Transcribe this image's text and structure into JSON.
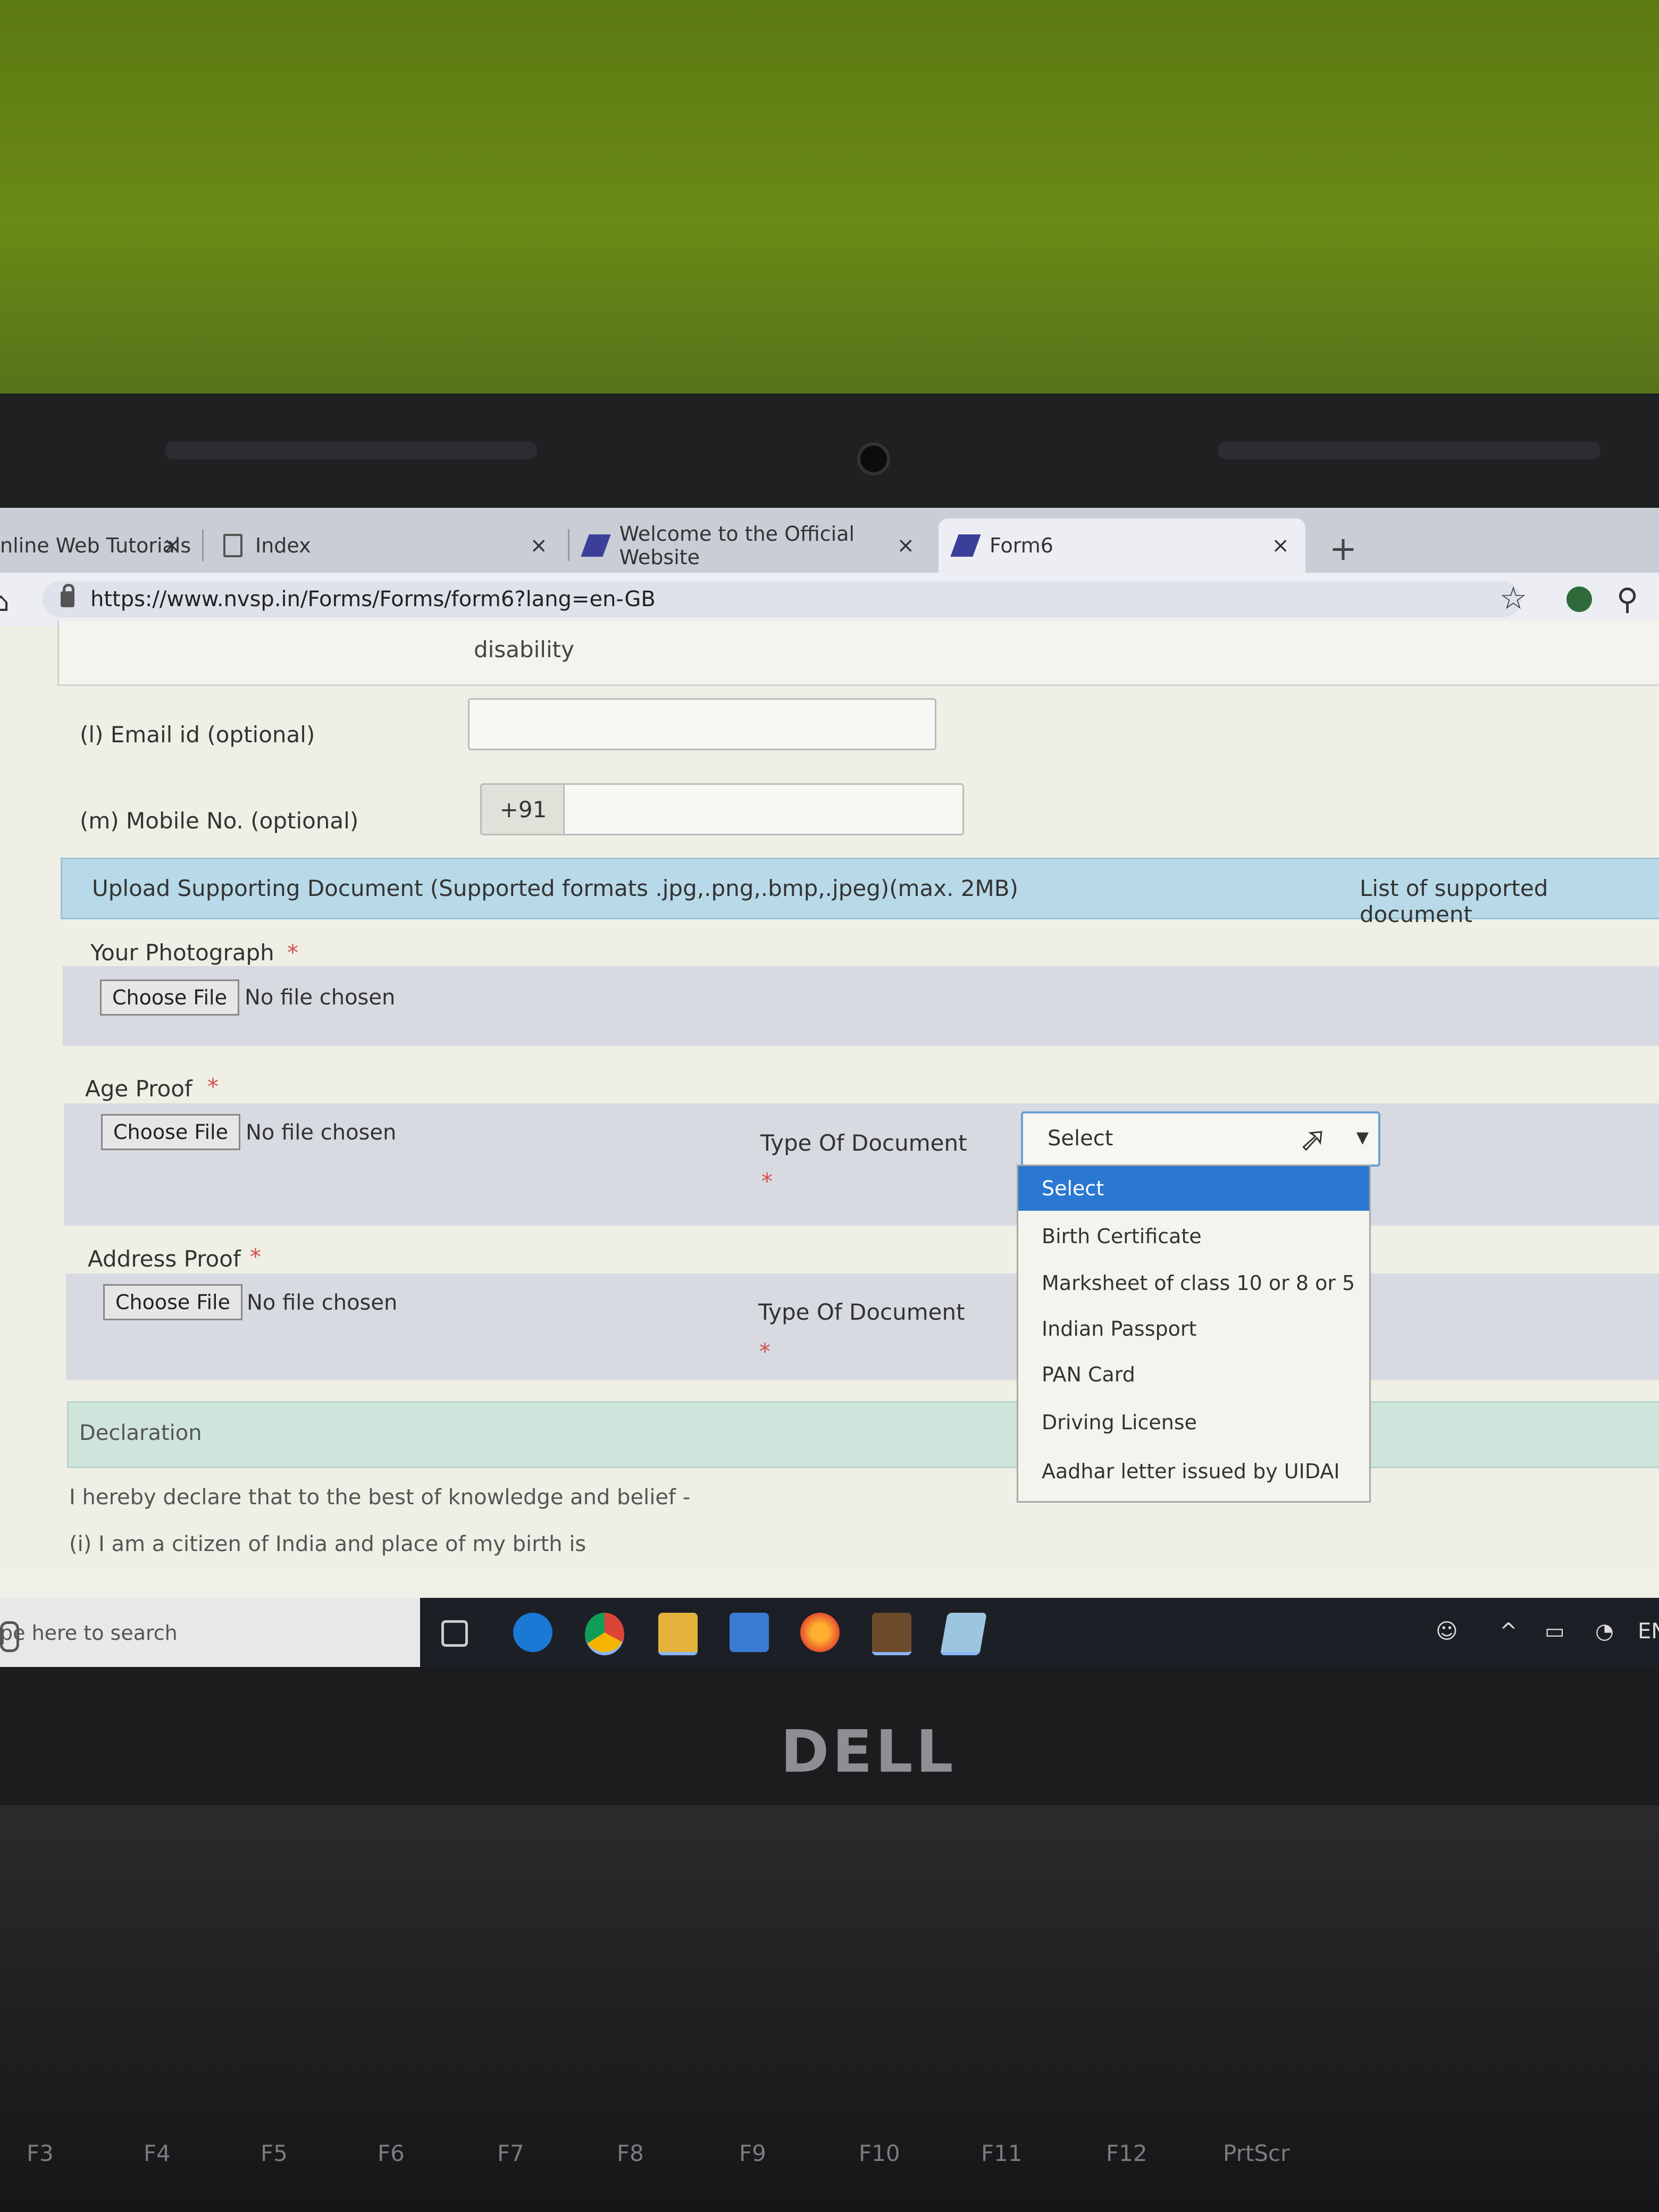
{
  "browser": {
    "tabs": [
      {
        "title": "nline Web Tutorials"
      },
      {
        "title": "Index"
      },
      {
        "title": "Welcome to the Official Website"
      },
      {
        "title": "Form6"
      }
    ],
    "close_glyph": "×",
    "new_tab_glyph": "+",
    "url": "https://www.nvsp.in/Forms/Forms/form6?lang=en-GB"
  },
  "form": {
    "disability_text": "disability",
    "email_label": "(l) Email id (optional)",
    "email_value": "",
    "mobile_label": "(m) Mobile No. (optional)",
    "mobile_prefix": "+91",
    "mobile_value": "",
    "upload_header": "Upload Supporting Document (Supported formats .jpg,.png,.bmp,.jpeg)(max. 2MB)",
    "supported_list_link": "List of supported document",
    "required_mark": "*",
    "photo": {
      "label": "Your Photograph",
      "button": "Choose File",
      "status": "No file chosen"
    },
    "age_proof": {
      "label": "Age Proof",
      "button": "Choose File",
      "status": "No file chosen",
      "doc_type_label": "Type Of Document",
      "select_value": "Select"
    },
    "address_proof": {
      "label": "Address Proof",
      "button": "Choose File",
      "status": "No file chosen",
      "doc_type_label": "Type Of Document"
    },
    "declaration_header": "Declaration",
    "declaration_text": "I hereby declare that to the best of knowledge and belief -",
    "declaration_item_1": "(i) I am a citizen of India and place of my birth is"
  },
  "dropdown": {
    "options": [
      "Select",
      "Birth Certificate",
      "Marksheet of class 10 or 8 or 5",
      "Indian Passport",
      "PAN Card",
      "Driving License",
      "Aadhar letter issued by UIDAI"
    ],
    "selected_index": 0,
    "highlight_color": "#2a78d2"
  },
  "taskbar": {
    "search_placeholder": "pe here to search",
    "language": "EN",
    "icons": [
      "task-view-icon",
      "edge-icon",
      "chrome-icon",
      "file-explorer-icon",
      "store-icon",
      "firefox-icon",
      "app-icon",
      "notes-icon"
    ]
  },
  "hardware": {
    "brand": "DELL",
    "function_keys": [
      "F3",
      "F4",
      "F5",
      "F6",
      "F7",
      "F8",
      "F9",
      "F10",
      "F11",
      "F12",
      "PrtScr"
    ]
  }
}
